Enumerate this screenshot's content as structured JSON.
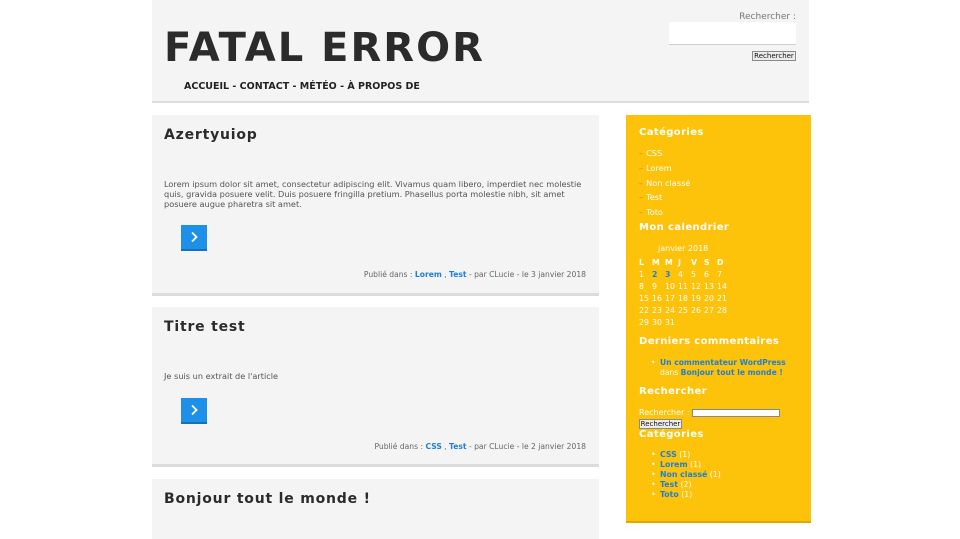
{
  "header": {
    "site_title": "FATAL ERROR",
    "nav": {
      "home": "ACCUEIL",
      "contact": "CONTACT",
      "weather": "MÉTÉO",
      "about": "À PROPOS DE",
      "separator": " - "
    },
    "search": {
      "label": "Rechercher :",
      "button": "Rechercher"
    }
  },
  "posts": [
    {
      "title": "Azertyuiop",
      "excerpt": "Lorem ipsum dolor sit amet, consectetur adipiscing elit. Vivamus quam libero, imperdiet nec molestie quis, gravida posuere velit. Duis posuere fringilla pretium. Phasellus porta molestie nibh, sit amet posuere augue pharetra sit amet.",
      "meta_prefix": "Publié dans :",
      "categories": [
        "Lorem",
        "Test"
      ],
      "cat_separator": " , ",
      "meta_suffix": " - par CLucie - le 3 janvier 2018"
    },
    {
      "title": "Titre test",
      "excerpt": "Je suis un extrait de l'article",
      "meta_prefix": "Publié dans :",
      "categories": [
        "CSS",
        "Test"
      ],
      "cat_separator": " , ",
      "meta_suffix": " - par CLucie - le 2 janvier 2018"
    },
    {
      "title": "Bonjour tout le monde !"
    }
  ],
  "sidebar": {
    "categories_title": "Catégories",
    "categories": [
      "CSS",
      "Lorem",
      "Non classé",
      "Test",
      "Toto"
    ],
    "calendar_title": "Mon calendrier",
    "calendar": {
      "caption": "janvier 2018",
      "weekdays": [
        "L",
        "M",
        "M",
        "J",
        "V",
        "S",
        "D"
      ],
      "weeks": [
        [
          "1",
          "2",
          "3",
          "4",
          "5",
          "6",
          "7"
        ],
        [
          "8",
          "9",
          "10",
          "11",
          "12",
          "13",
          "14"
        ],
        [
          "15",
          "16",
          "17",
          "18",
          "19",
          "20",
          "21"
        ],
        [
          "22",
          "23",
          "24",
          "25",
          "26",
          "27",
          "28"
        ],
        [
          "29",
          "30",
          "31",
          "",
          "",
          "",
          ""
        ]
      ],
      "linked_days": [
        "2",
        "3"
      ]
    },
    "recent_comments_title": "Derniers commentaires",
    "recent_comment": {
      "author": "Un commentateur WordPress",
      "connector": " dans ",
      "post": "Bonjour tout le monde !"
    },
    "search_title": "Rechercher",
    "search_label": "Rechercher :",
    "search_button": "Rechercher",
    "categories2_title": "Catégories",
    "categories2": [
      {
        "name": "CSS",
        "count": "(1)"
      },
      {
        "name": "Lorem",
        "count": "(1)"
      },
      {
        "name": "Non classé",
        "count": "(1)"
      },
      {
        "name": "Test",
        "count": "(2)"
      },
      {
        "name": "Toto",
        "count": "(1)"
      }
    ]
  },
  "colors": {
    "accent_blue": "#1e90e8",
    "sidebar_yellow": "#fdc20a",
    "panel_gray": "#f4f4f4"
  },
  "icons": {
    "read_more": "chevron-right-icon"
  }
}
